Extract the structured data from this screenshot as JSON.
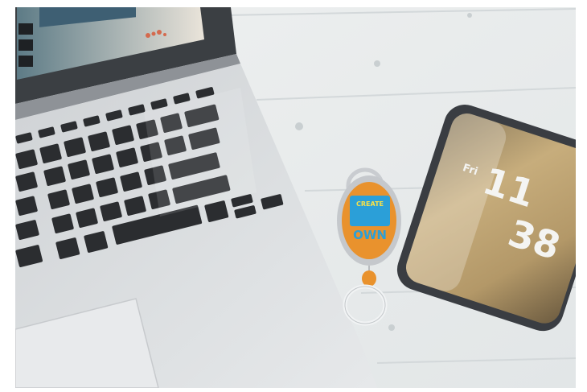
{
  "phone": {
    "day": "Fri",
    "hour": "11",
    "minute": "38"
  },
  "keyring_badge": {
    "line1": "CREATE",
    "line3": "OWN"
  },
  "colors": {
    "desk": "#e9ecec",
    "laptop_body": "#d7d9dc",
    "keyboard_key": "#2b2d30",
    "badge_orange": "#e9922d",
    "badge_blue": "#2b9fd8",
    "phone_screen": "#bfa676"
  }
}
